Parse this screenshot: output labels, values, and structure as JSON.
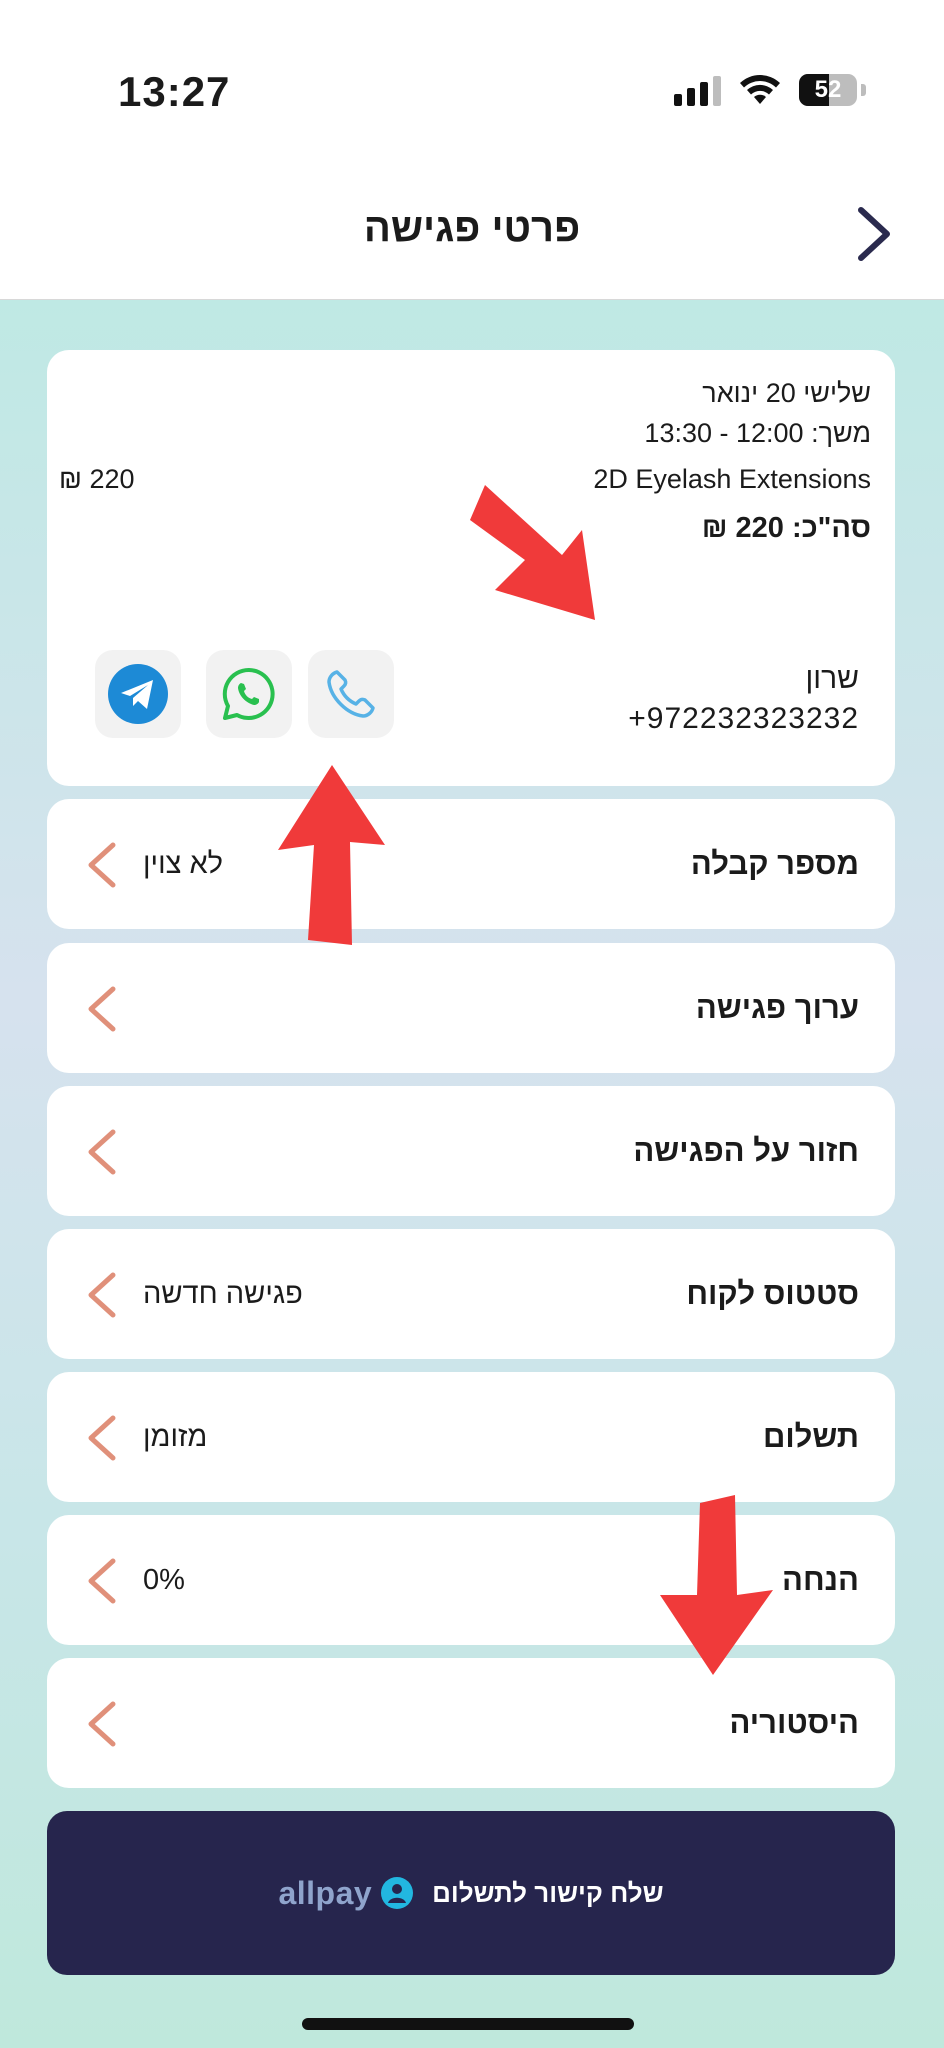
{
  "status_bar": {
    "time": "13:27",
    "battery": "52"
  },
  "header": {
    "title": "פרטי פגישה"
  },
  "appointment": {
    "date": "שלישי 20 ינואר",
    "duration": "משך: 12:00 - 13:30",
    "service": "2D Eyelash Extensions",
    "price": "220 ₪",
    "total": "סה\"כ: 220 ₪",
    "client_name": "שרון",
    "client_phone": "+972232323232"
  },
  "rows": [
    {
      "label": "מספר קבלה",
      "value": "לא צוין"
    },
    {
      "label": "ערוך פגישה",
      "value": ""
    },
    {
      "label": "חזור על הפגישה",
      "value": ""
    },
    {
      "label": "סטטוס לקוח",
      "value": "פגישה חדשה"
    },
    {
      "label": "תשלום",
      "value": "מזומן"
    },
    {
      "label": "הנחה",
      "value": "0%"
    },
    {
      "label": "היסטוריה",
      "value": ""
    }
  ],
  "payment_button": {
    "label": "שלח קישור לתשלום",
    "brand": "allpay"
  },
  "colors": {
    "accent": "#26254d",
    "chevron": "#e0907a",
    "annotation_arrow": "#f03a3a"
  }
}
